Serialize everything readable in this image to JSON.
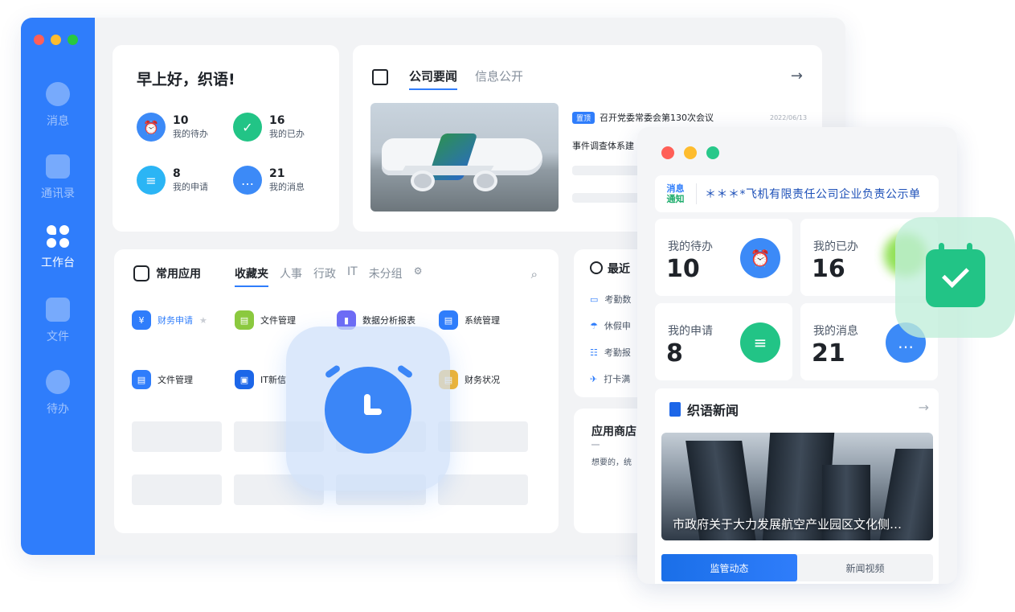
{
  "sidebar": {
    "items": [
      {
        "label": "消息",
        "icon": "message-icon"
      },
      {
        "label": "通讯录",
        "icon": "contacts-icon"
      },
      {
        "label": "工作台",
        "icon": "workbench-icon"
      },
      {
        "label": "文件",
        "icon": "folder-icon"
      },
      {
        "label": "待办",
        "icon": "todo-icon"
      }
    ]
  },
  "greeting": {
    "title": "早上好，织语!",
    "stats": [
      {
        "num": "10",
        "label": "我的待办",
        "color": "#3c8af7"
      },
      {
        "num": "16",
        "label": "我的已办",
        "color": "#22c486"
      },
      {
        "num": "8",
        "label": "我的申请",
        "color": "#2bb5f5"
      },
      {
        "num": "21",
        "label": "我的消息",
        "color": "#3c8af7"
      }
    ]
  },
  "news": {
    "tabs": [
      "公司要闻",
      "信息公开"
    ],
    "badge": "置顶",
    "headline": "召开党委常委会第130次会议",
    "date": "2022/06/13",
    "second": "事件调查体系建"
  },
  "apps": {
    "title": "常用应用",
    "tabs": [
      "收藏夹",
      "人事",
      "行政",
      "IT",
      "未分组"
    ],
    "items": [
      {
        "label": "财务申请",
        "color": "#2f7dfb"
      },
      {
        "label": "文件管理",
        "color": "#8bc93f"
      },
      {
        "label": "数据分析报表",
        "color": "#6e6cf5"
      },
      {
        "label": "系统管理",
        "color": "#2f7dfb"
      },
      {
        "label": "文件管理",
        "color": "#2f7dfb"
      },
      {
        "label": "IT新信",
        "color": "#1c66e8"
      },
      {
        "label": "财务状况",
        "color": "#f5b731"
      }
    ]
  },
  "recent": {
    "title": "最近",
    "items": [
      "考勤数",
      "休假申",
      "考勤报",
      "打卡满"
    ]
  },
  "store": {
    "title": "应用商店",
    "desc": "想要的，统"
  },
  "mobile": {
    "notice_tag_1": "消息",
    "notice_tag_2": "通知",
    "notice_text": "＊＊＊*飞机有限责任公司企业负责公示单",
    "stats": [
      {
        "label": "我的待办",
        "num": "10",
        "color": "#3c8af7"
      },
      {
        "label": "我的已办",
        "num": "16",
        "color": "#22c486"
      },
      {
        "label": "我的申请",
        "num": "8",
        "color": "#22c486"
      },
      {
        "label": "我的消息",
        "num": "21",
        "color": "#3c8af7"
      }
    ],
    "news_title": "织语新闻",
    "caption": "市政府关于大力发展航空产业园区文化侧…",
    "segments": [
      "监管动态",
      "新闻视频"
    ]
  }
}
